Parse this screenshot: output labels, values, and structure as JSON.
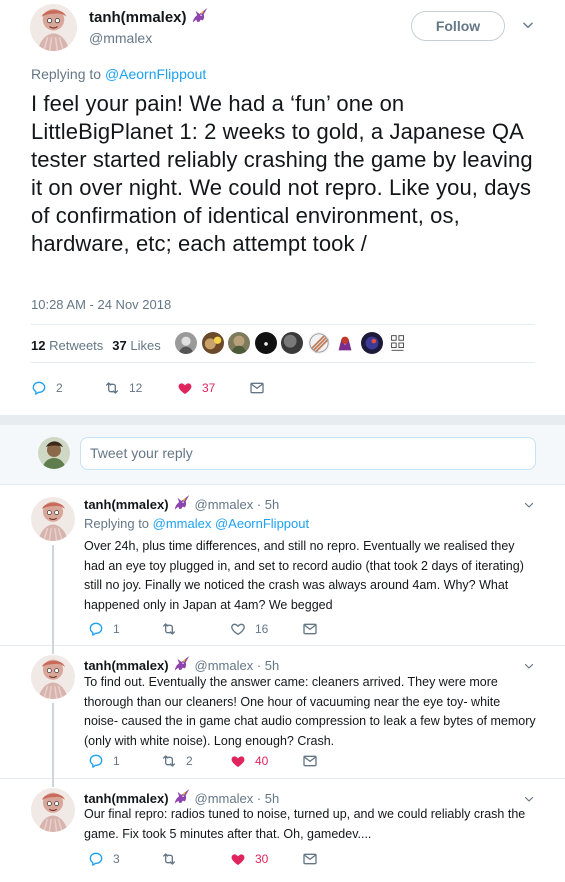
{
  "colors": {
    "link": "#1da1f2",
    "like": "#e0245e",
    "muted": "#657786",
    "divider": "#e6ecf0"
  },
  "main": {
    "name": "tanh(mmalex)",
    "handle": "@mmalex",
    "follow_label": "Follow",
    "replying_prefix": "Replying to ",
    "replying_to": "@AeornFlippout",
    "text": "I feel your pain! We had a ‘fun’ one on LittleBigPlanet 1: 2 weeks to gold, a Japanese QA tester started reliably crashing the game by leaving it on over night. We could not repro. Like you, days of confirmation of identical environment, os, hardware, etc; each attempt took /",
    "timestamp": "10:28 AM - 24 Nov 2018",
    "retweets_count": "12",
    "retweets_label": "Retweets",
    "likes_count": "37",
    "likes_label": "Likes",
    "actions": {
      "replies": "2",
      "retweets": "12",
      "likes": "37"
    }
  },
  "reply_box": {
    "placeholder": "Tweet your reply"
  },
  "replies": [
    {
      "name": "tanh(mmalex)",
      "handle": "@mmalex",
      "time": "· 5h",
      "replying_prefix": "Replying to ",
      "replying_to": "@mmalex @AeornFlippout",
      "text": "Over 24h, plus time differences, and still no repro. Eventually we realised they had an eye toy plugged in, and set to record audio (that took 2 days of iterating) still no joy. Finally we noticed the crash was always around 4am. Why? What happened only in Japan at 4am? We begged",
      "replies": "1",
      "retweets": "",
      "likes": "16",
      "liked": false
    },
    {
      "name": "tanh(mmalex)",
      "handle": "@mmalex",
      "time": "· 5h",
      "text": "To find out. Eventually the answer came: cleaners arrived. They were more thorough than our cleaners! One hour of vacuuming near the eye toy- white noise- caused the in game chat audio compression to leak a few bytes of memory (only with white noise). Long enough? Crash.",
      "replies": "1",
      "retweets": "2",
      "likes": "40",
      "liked": true
    },
    {
      "name": "tanh(mmalex)",
      "handle": "@mmalex",
      "time": "· 5h",
      "text": "Our final repro: radios tuned to noise, turned up, and we could reliably crash the game. Fix took 5 minutes after that. Oh, gamedev....",
      "replies": "3",
      "retweets": "",
      "likes": "30",
      "liked": true
    }
  ]
}
